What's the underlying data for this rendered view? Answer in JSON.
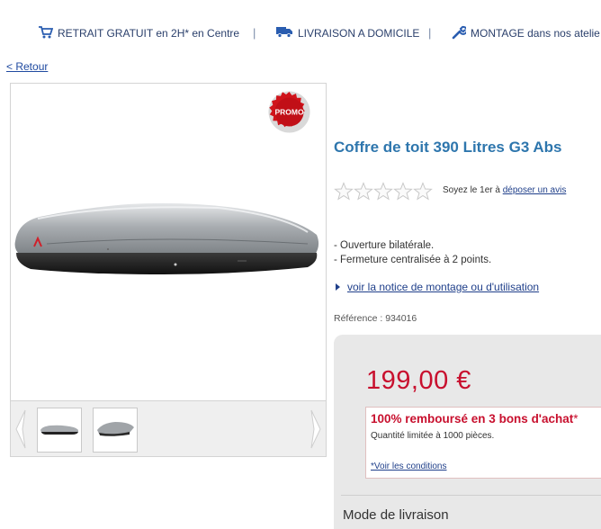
{
  "topbar": {
    "items": [
      {
        "label": "RETRAIT GRATUIT en 2H* en Centre",
        "icon": "cart-icon"
      },
      {
        "label": "LIVRAISON A DOMICILE",
        "icon": "truck-icon"
      },
      {
        "label": "MONTAGE dans nos atelie",
        "icon": "wrench-icon"
      }
    ],
    "separator": "|"
  },
  "back_link": "< Retour",
  "gallery": {
    "promo_badge": "PROMO",
    "thumbnails": [
      "thumbnail-1",
      "thumbnail-2"
    ]
  },
  "product": {
    "title": "Coffre de toit 390 Litres G3 Abs",
    "rating": {
      "stars_filled": 0,
      "stars_total": 5,
      "prefix": "Soyez le 1er à ",
      "link": "déposer un avis"
    },
    "features": [
      "- Ouverture bilatérale.",
      "- Fermeture centralisée à 2 points."
    ],
    "notice_link": "voir la notice de montage ou d'utilisation",
    "reference": "Référence : 934016"
  },
  "pricing": {
    "price": "199,00 €",
    "promo_headline": "100% remboursé en 3 bons d'achat",
    "promo_asterisk": "*",
    "promo_limit": "Quantité limitée à 1000 pièces.",
    "conditions_link": "*Voir les conditions",
    "delivery_title": "Mode de livraison"
  },
  "colors": {
    "title_blue": "#2e76ad",
    "price_red": "#c8102e",
    "link_blue": "#1f3f8a",
    "nav_blue": "#2a3f6b"
  }
}
